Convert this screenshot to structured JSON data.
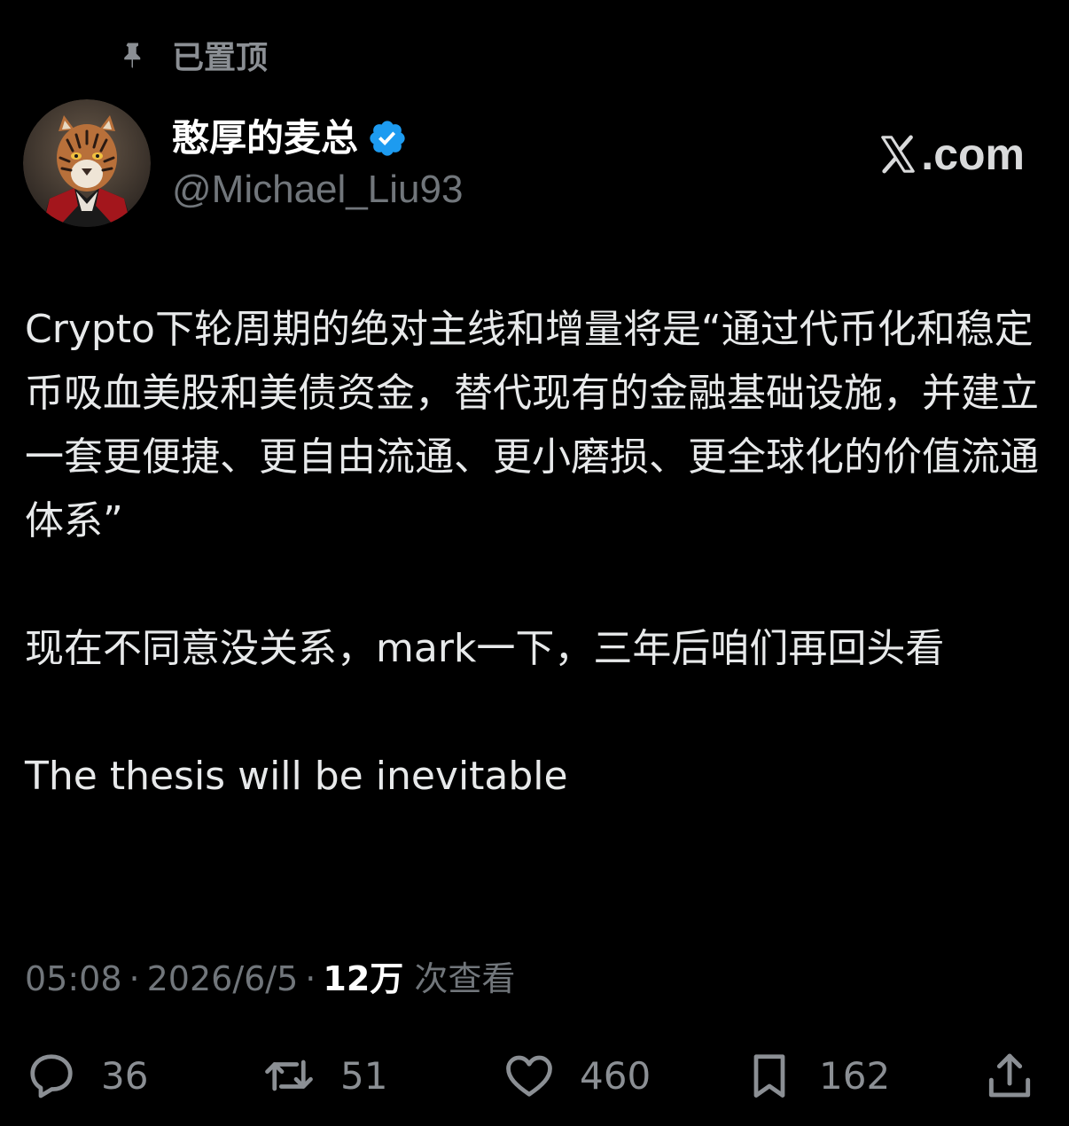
{
  "pinned": {
    "label": "已置顶",
    "icon": "pin-icon"
  },
  "author": {
    "display_name": "憨厚的麦总",
    "handle": "@Michael_Liu93",
    "verified": true,
    "verified_color": "#1d9bf0"
  },
  "brand": {
    "text": ".com",
    "icon": "x-logo-icon"
  },
  "tweet": {
    "paragraphs": [
      "Crypto下轮周期的绝对主线和增量将是“通过代币化和稳定币吸血美股和美债资金，替代现有的金融基础设施，并建立一套更便捷、更自由流通、更小磨损、更全球化的价值流通体系”",
      "现在不同意没关系，mark一下，三年后咱们再回头看",
      "The thesis will be inevitable"
    ]
  },
  "meta": {
    "time": "05:08",
    "separator": "·",
    "date": "2026/6/5",
    "views_count": "12万",
    "views_label": "次查看"
  },
  "actions": {
    "reply": {
      "count": "36",
      "icon": "reply-icon"
    },
    "repost": {
      "count": "51",
      "icon": "repost-icon"
    },
    "like": {
      "count": "460",
      "icon": "heart-icon"
    },
    "bookmark": {
      "count": "162",
      "icon": "bookmark-icon"
    },
    "share": {
      "icon": "share-icon"
    }
  },
  "colors": {
    "background": "#000000",
    "text": "#e7e9ea",
    "secondary": "#71767b",
    "verified": "#1d9bf0"
  }
}
